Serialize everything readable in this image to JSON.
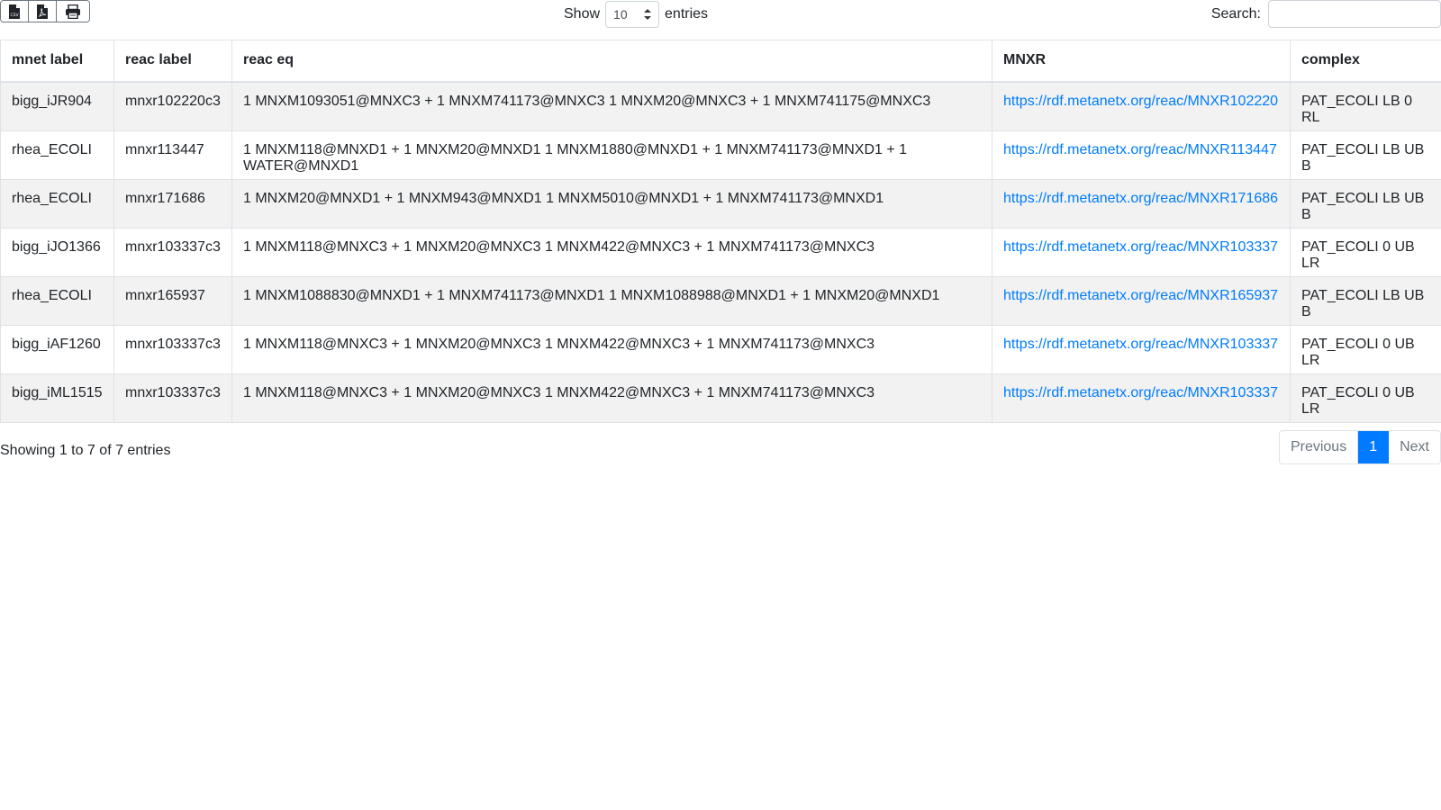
{
  "toolbar": {
    "export_buttons": [
      {
        "icon": "csv-file-icon"
      },
      {
        "icon": "pdf-file-icon"
      },
      {
        "icon": "print-icon"
      }
    ]
  },
  "length_menu": {
    "prefix": "Show",
    "value": "10",
    "suffix": "entries"
  },
  "search": {
    "label": "Search:",
    "value": ""
  },
  "table": {
    "columns": [
      "mnet label",
      "reac label",
      "reac eq",
      "MNXR",
      "complex"
    ],
    "rows": [
      {
        "mnet": "bigg_iJR904",
        "reac": "mnxr102220c3",
        "eq": "1 MNXM1093051@MNXC3 + 1 MNXM741173@MNXC3 1 MNXM20@MNXC3 + 1 MNXM741175@MNXC3",
        "mnxr": "https://rdf.metanetx.org/reac/MNXR102220",
        "complex": "PAT_ECOLI LB 0 RL"
      },
      {
        "mnet": "rhea_ECOLI",
        "reac": "mnxr113447",
        "eq": "1 MNXM118@MNXD1 + 1 MNXM20@MNXD1 1 MNXM1880@MNXD1 + 1 MNXM741173@MNXD1 + 1 WATER@MNXD1",
        "mnxr": "https://rdf.metanetx.org/reac/MNXR113447",
        "complex": "PAT_ECOLI LB UB B"
      },
      {
        "mnet": "rhea_ECOLI",
        "reac": "mnxr171686",
        "eq": "1 MNXM20@MNXD1 + 1 MNXM943@MNXD1 1 MNXM5010@MNXD1 + 1 MNXM741173@MNXD1",
        "mnxr": "https://rdf.metanetx.org/reac/MNXR171686",
        "complex": "PAT_ECOLI LB UB B"
      },
      {
        "mnet": "bigg_iJO1366",
        "reac": "mnxr103337c3",
        "eq": "1 MNXM118@MNXC3 + 1 MNXM20@MNXC3 1 MNXM422@MNXC3 + 1 MNXM741173@MNXC3",
        "mnxr": "https://rdf.metanetx.org/reac/MNXR103337",
        "complex": "PAT_ECOLI 0 UB LR"
      },
      {
        "mnet": "rhea_ECOLI",
        "reac": "mnxr165937",
        "eq": "1 MNXM1088830@MNXD1 + 1 MNXM741173@MNXD1 1 MNXM1088988@MNXD1 + 1 MNXM20@MNXD1",
        "mnxr": "https://rdf.metanetx.org/reac/MNXR165937",
        "complex": "PAT_ECOLI LB UB B"
      },
      {
        "mnet": "bigg_iAF1260",
        "reac": "mnxr103337c3",
        "eq": "1 MNXM118@MNXC3 + 1 MNXM20@MNXC3 1 MNXM422@MNXC3 + 1 MNXM741173@MNXC3",
        "mnxr": "https://rdf.metanetx.org/reac/MNXR103337",
        "complex": "PAT_ECOLI 0 UB LR"
      },
      {
        "mnet": "bigg_iML1515",
        "reac": "mnxr103337c3",
        "eq": "1 MNXM118@MNXC3 + 1 MNXM20@MNXC3 1 MNXM422@MNXC3 + 1 MNXM741173@MNXC3",
        "mnxr": "https://rdf.metanetx.org/reac/MNXR103337",
        "complex": "PAT_ECOLI 0 UB LR"
      }
    ]
  },
  "footer": {
    "info": "Showing 1 to 7 of 7 entries",
    "pagination": {
      "previous": "Previous",
      "current": "1",
      "next": "Next"
    }
  },
  "colors": {
    "link": "#007bff",
    "stripe": "#f2f2f2",
    "active_page": "#007bff"
  }
}
